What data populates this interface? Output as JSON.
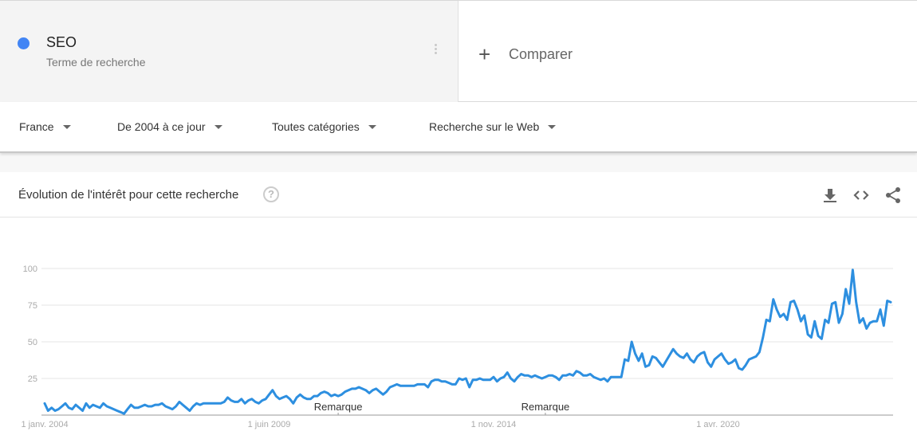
{
  "term": {
    "name": "SEO",
    "subtitle": "Terme de recherche",
    "color": "#4285f4"
  },
  "compare": {
    "icon": "plus-icon",
    "label": "Comparer"
  },
  "filters": [
    {
      "label": "France"
    },
    {
      "label": "De 2004 à ce jour"
    },
    {
      "label": "Toutes catégories"
    },
    {
      "label": "Recherche sur le Web"
    }
  ],
  "panel": {
    "title": "Évolution de l'intérêt pour cette recherche",
    "help_icon": "help-icon",
    "help_glyph": "?",
    "actions": [
      "download-icon",
      "embed-icon",
      "share-icon"
    ]
  },
  "chart_data": {
    "type": "line",
    "title": "Évolution de l'intérêt pour cette recherche",
    "xlabel": "",
    "ylabel": "",
    "ylim": [
      0,
      100
    ],
    "yticks": [
      25,
      50,
      75,
      100
    ],
    "grid": true,
    "x_start": "2004-01",
    "x_step": "month",
    "xtick_labels": [
      {
        "label": "1 janv. 2004",
        "month_index": 0
      },
      {
        "label": "1 juin 2009",
        "month_index": 65
      },
      {
        "label": "1 nov. 2014",
        "month_index": 130
      },
      {
        "label": "1 avr. 2020",
        "month_index": 195
      }
    ],
    "annotations": [
      {
        "label": "Remarque",
        "month_index": 85
      },
      {
        "label": "Remarque",
        "month_index": 145
      }
    ],
    "line_color": "#2d8fe0",
    "series": [
      {
        "name": "SEO",
        "values": [
          8,
          3,
          5,
          3,
          4,
          6,
          8,
          5,
          4,
          7,
          5,
          3,
          8,
          5,
          7,
          6,
          5,
          8,
          6,
          5,
          4,
          3,
          2,
          1,
          4,
          7,
          5,
          5,
          6,
          7,
          6,
          6,
          7,
          7,
          8,
          6,
          5,
          4,
          6,
          9,
          7,
          5,
          3,
          6,
          8,
          7,
          8,
          8,
          8,
          8,
          8,
          8,
          9,
          12,
          10,
          9,
          9,
          11,
          8,
          10,
          11,
          9,
          8,
          10,
          11,
          14,
          17,
          13,
          11,
          12,
          13,
          11,
          8,
          12,
          14,
          12,
          11,
          11,
          13,
          13,
          15,
          16,
          15,
          13,
          14,
          13,
          14,
          16,
          17,
          18,
          18,
          19,
          18,
          17,
          15,
          17,
          18,
          16,
          14,
          16,
          19,
          20,
          21,
          20,
          20,
          20,
          20,
          20,
          21,
          21,
          21,
          19,
          23,
          24,
          24,
          23,
          23,
          22,
          21,
          21,
          25,
          24,
          25,
          19,
          24,
          24,
          25,
          24,
          24,
          24,
          26,
          23,
          25,
          26,
          29,
          25,
          23,
          26,
          28,
          27,
          27,
          26,
          27,
          26,
          25,
          26,
          27,
          27,
          26,
          24,
          27,
          27,
          28,
          27,
          30,
          29,
          27,
          27,
          28,
          26,
          25,
          24,
          25,
          23,
          26,
          26,
          26,
          26,
          38,
          37,
          50,
          42,
          37,
          42,
          33,
          34,
          40,
          39,
          36,
          33,
          37,
          41,
          45,
          42,
          40,
          39,
          42,
          38,
          36,
          40,
          42,
          43,
          36,
          33,
          38,
          40,
          42,
          38,
          35,
          36,
          38,
          32,
          31,
          34,
          38,
          39,
          40,
          43,
          53,
          65,
          64,
          79,
          72,
          67,
          69,
          65,
          77,
          78,
          72,
          64,
          68,
          55,
          53,
          64,
          54,
          52,
          65,
          63,
          76,
          77,
          63,
          69,
          86,
          76,
          99,
          77,
          63,
          66,
          59,
          63,
          64,
          64,
          72,
          61,
          78,
          77
        ]
      }
    ]
  }
}
